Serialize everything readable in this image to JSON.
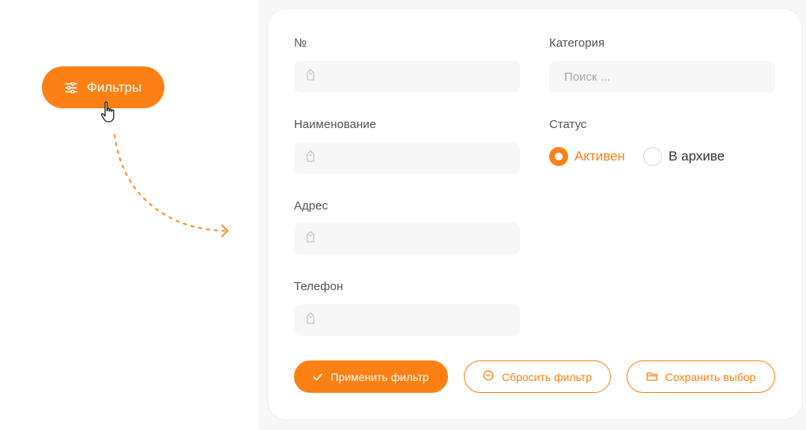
{
  "left": {
    "filters_button_label": "Фильтры",
    "filters_icon": "sliders-icon",
    "cursor_icon": "hand-pointer-icon"
  },
  "form": {
    "number": {
      "label": "№",
      "value": "",
      "icon": "tag-icon"
    },
    "name": {
      "label": "Наименование",
      "value": "",
      "icon": "tag-icon"
    },
    "address": {
      "label": "Адрес",
      "value": "",
      "icon": "tag-icon"
    },
    "phone": {
      "label": "Телефон",
      "value": "",
      "icon": "tag-icon"
    },
    "category": {
      "label": "Категория",
      "value": "",
      "placeholder": "Поиск ..."
    },
    "status": {
      "label": "Статус",
      "options": [
        {
          "label": "Активен",
          "selected": true
        },
        {
          "label": "В архиве",
          "selected": false
        }
      ]
    }
  },
  "buttons": {
    "apply": {
      "label": "Применить фильтр",
      "icon": "check-icon"
    },
    "reset": {
      "label": "Сбросить фильтр",
      "icon": "minus-circle-icon"
    },
    "save": {
      "label": "Сохранить выбор",
      "icon": "folder-icon"
    }
  },
  "colors": {
    "accent": "#fd8015",
    "input_bg": "#f7f7f7",
    "label": "#555555"
  }
}
